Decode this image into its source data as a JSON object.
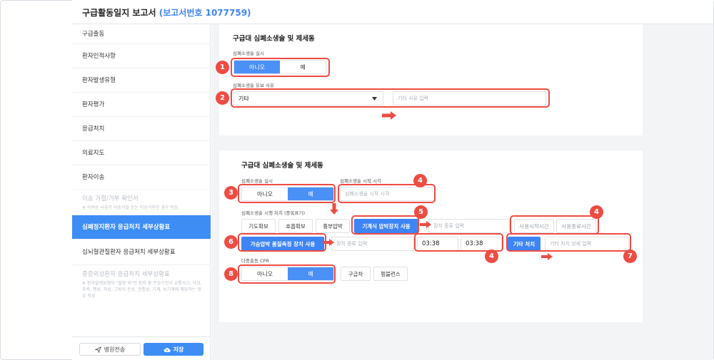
{
  "header": {
    "title": "구급활동일지 보고서",
    "report_no": "(보고서번호 1077759)"
  },
  "sidebar": {
    "items": [
      {
        "label": "구급출동"
      },
      {
        "label": "환자인적사항"
      },
      {
        "label": "환자발생유형"
      },
      {
        "label": "환자평가"
      },
      {
        "label": "응급처치"
      },
      {
        "label": "의료지도"
      },
      {
        "label": "환자이송"
      },
      {
        "label": "이송 거절/거부 확인서",
        "note": "※ 이여송 사유가 이송거절 또는 이송거부인 경우 작성"
      },
      {
        "label": "심폐정지환자 응급처치 세부상황표"
      },
      {
        "label": "심뇌혈관질환자 응급처치 세부상황표"
      },
      {
        "label": "중증외상환자 응급처치 세부상황표",
        "note": "※ 환자발생유형이 \"질병 외\"인 환자 중 손상기전이 교통사고, 낙상, 추락, 행성, 자상, 그밖의 둔상, 관통상, 기계, 농기계에 해당하는 경우 작성"
      }
    ],
    "send_button": "병원전송",
    "save_button": "저장"
  },
  "section1": {
    "title": "구급대 심폐소생술 및 제세동",
    "cpr_label": "심폐소생술 실시",
    "toggle": {
      "no": "아니오",
      "yes": "예"
    },
    "reason_label": "심폐소생술 유보 사유",
    "reason_value": "기타",
    "reason_placeholder": "기타 사유 입력"
  },
  "section2": {
    "title": "구급대 심폐소생술 및 제세동",
    "cpr_label": "심폐소생술 실시",
    "start_time_label": "심폐소생술 시작 시각",
    "toggle": {
      "no": "아니오",
      "yes": "예"
    },
    "start_time_placeholder": "심폐소생술 시작 시각",
    "measures_label": "심폐소생술 시행 처치 (중복표기)",
    "buttons": {
      "airway": "기도확보",
      "breathing": "호흡확보",
      "chest_compression": "흉부압박",
      "mechanical_cpr": "기계식 압박장치 사용",
      "feedback_device": "가슴압박 품질측정 장치 사용",
      "other_treatment": "기타 처치"
    },
    "device_type_placeholder": "장치 종류 입력",
    "device_type_placeholder2": "장치 종류 입력",
    "use_start_time": "사용시작시간",
    "use_end_time": "사용종료시간",
    "time1": "03:38",
    "time2": "03:38",
    "other_detail_placeholder": "기타 처치 상세 입력",
    "multi_dispatch_label": "다중출동 CPR",
    "ambulance": "구급차",
    "pump": "펌블런스"
  },
  "markers": [
    "1",
    "2",
    "3",
    "4",
    "5",
    "6",
    "7",
    "8",
    "4",
    "4"
  ],
  "colors": {
    "accent": "#3d84f5",
    "highlight": "#ef4b43",
    "active_nav": "#3d8df5"
  }
}
